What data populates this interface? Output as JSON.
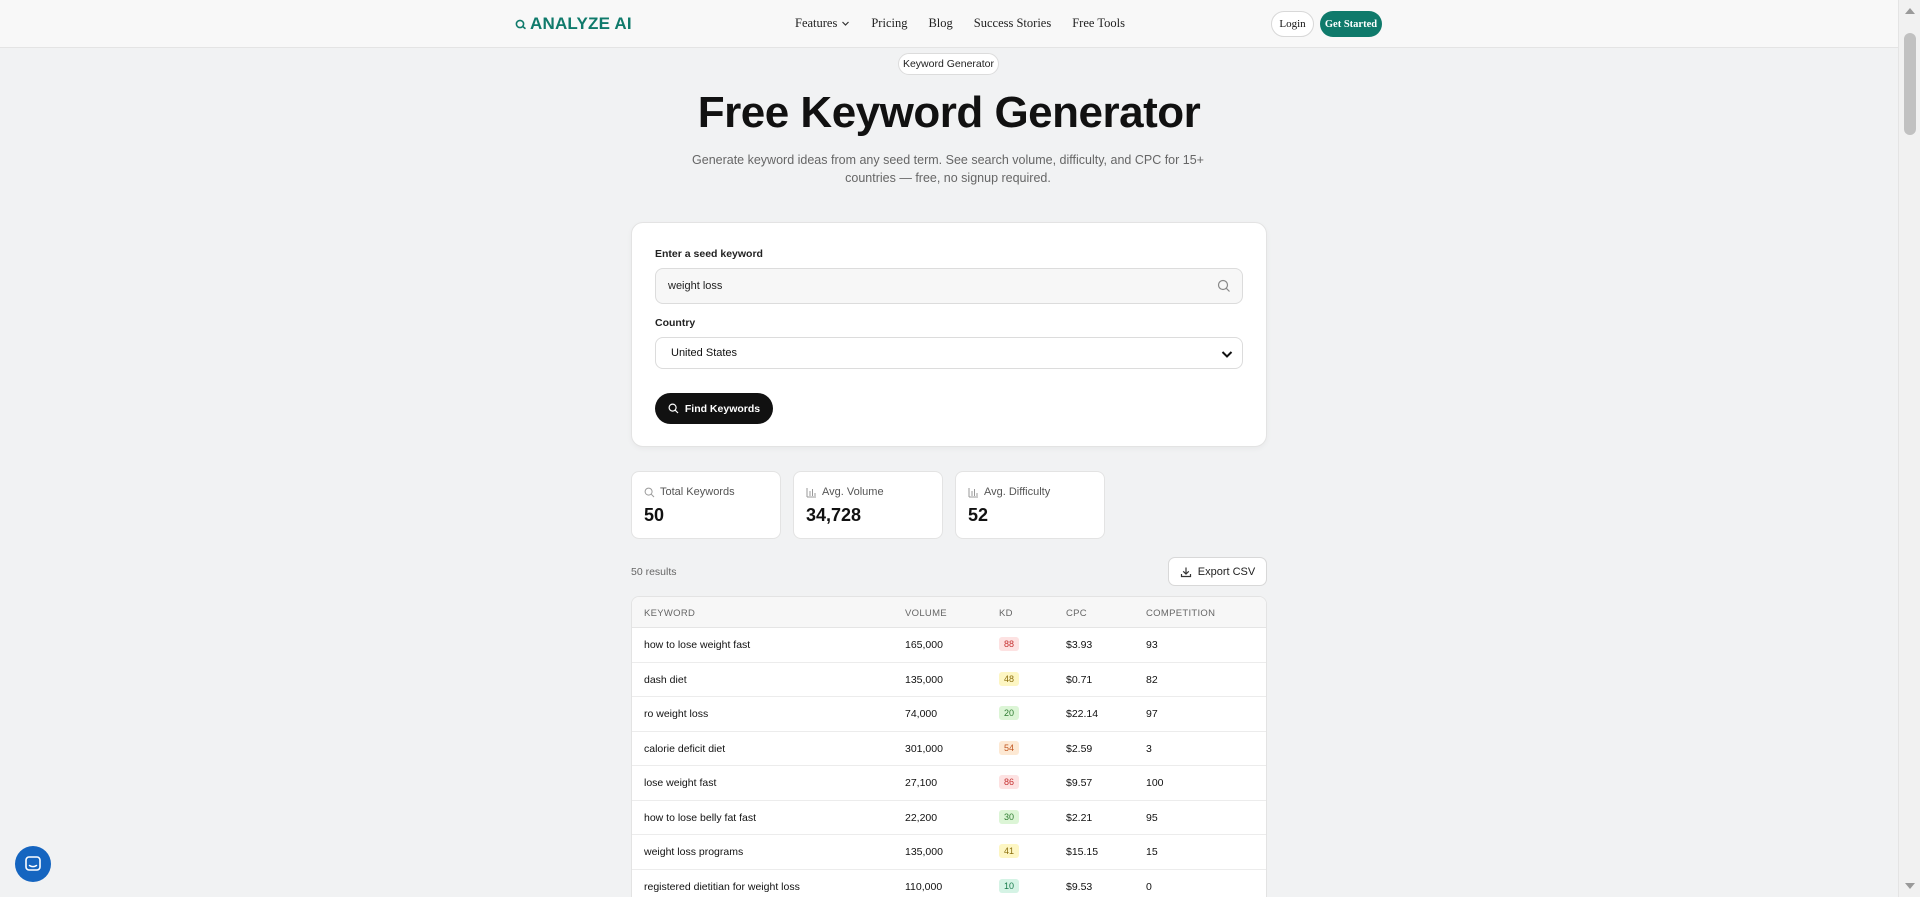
{
  "nav": {
    "logo": "ANALYZE AI",
    "links": [
      "Features",
      "Pricing",
      "Blog",
      "Success Stories",
      "Free Tools"
    ],
    "login": "Login",
    "get_started": "Get Started"
  },
  "hero": {
    "badge": "Keyword Generator",
    "title": "Free Keyword Generator",
    "subtitle": "Generate keyword ideas from any seed term. See search volume, difficulty, and CPC for 15+ countries — free, no signup required."
  },
  "form": {
    "seed_label": "Enter a seed keyword",
    "seed_value": "weight loss",
    "country_label": "Country",
    "country_value": "United States",
    "find_button": "Find Keywords"
  },
  "stats": [
    {
      "label": "Total Keywords",
      "value": "50",
      "icon": "search-icon"
    },
    {
      "label": "Avg. Volume",
      "value": "34,728",
      "icon": "bar-chart-icon"
    },
    {
      "label": "Avg. Difficulty",
      "value": "52",
      "icon": "bar-chart-icon"
    }
  ],
  "results": {
    "count_label": "50 results",
    "export_label": "Export CSV",
    "columns": [
      "KEYWORD",
      "VOLUME",
      "KD",
      "CPC",
      "COMPETITION"
    ],
    "rows": [
      {
        "keyword": "how to lose weight fast",
        "volume": "165,000",
        "kd": "88",
        "cpc": "$3.93",
        "competition": "93"
      },
      {
        "keyword": "dash diet",
        "volume": "135,000",
        "kd": "48",
        "cpc": "$0.71",
        "competition": "82"
      },
      {
        "keyword": "ro weight loss",
        "volume": "74,000",
        "kd": "20",
        "cpc": "$22.14",
        "competition": "97"
      },
      {
        "keyword": "calorie deficit diet",
        "volume": "301,000",
        "kd": "54",
        "cpc": "$2.59",
        "competition": "3"
      },
      {
        "keyword": "lose weight fast",
        "volume": "27,100",
        "kd": "86",
        "cpc": "$9.57",
        "competition": "100"
      },
      {
        "keyword": "how to lose belly fat fast",
        "volume": "22,200",
        "kd": "30",
        "cpc": "$2.21",
        "competition": "95"
      },
      {
        "keyword": "weight loss programs",
        "volume": "135,000",
        "kd": "41",
        "cpc": "$15.15",
        "competition": "15"
      },
      {
        "keyword": "registered dietitian for weight loss",
        "volume": "110,000",
        "kd": "10",
        "cpc": "$9.53",
        "competition": "0"
      }
    ]
  },
  "colors": {
    "brand": "#0f7a6b",
    "kd_hard_bg": "#fde2e2",
    "kd_hard_fg": "#c53030",
    "kd_medium_bg": "#fde9d4",
    "kd_medium_fg": "#c05621",
    "kd_easyish_bg": "#fdf6c3",
    "kd_easyish_fg": "#8a6d0b",
    "kd_easy_bg": "#dcf5d6",
    "kd_easy_fg": "#2f7d32",
    "kd_veryeasy_bg": "#d5f3e5",
    "kd_veryeasy_fg": "#177a4b"
  }
}
